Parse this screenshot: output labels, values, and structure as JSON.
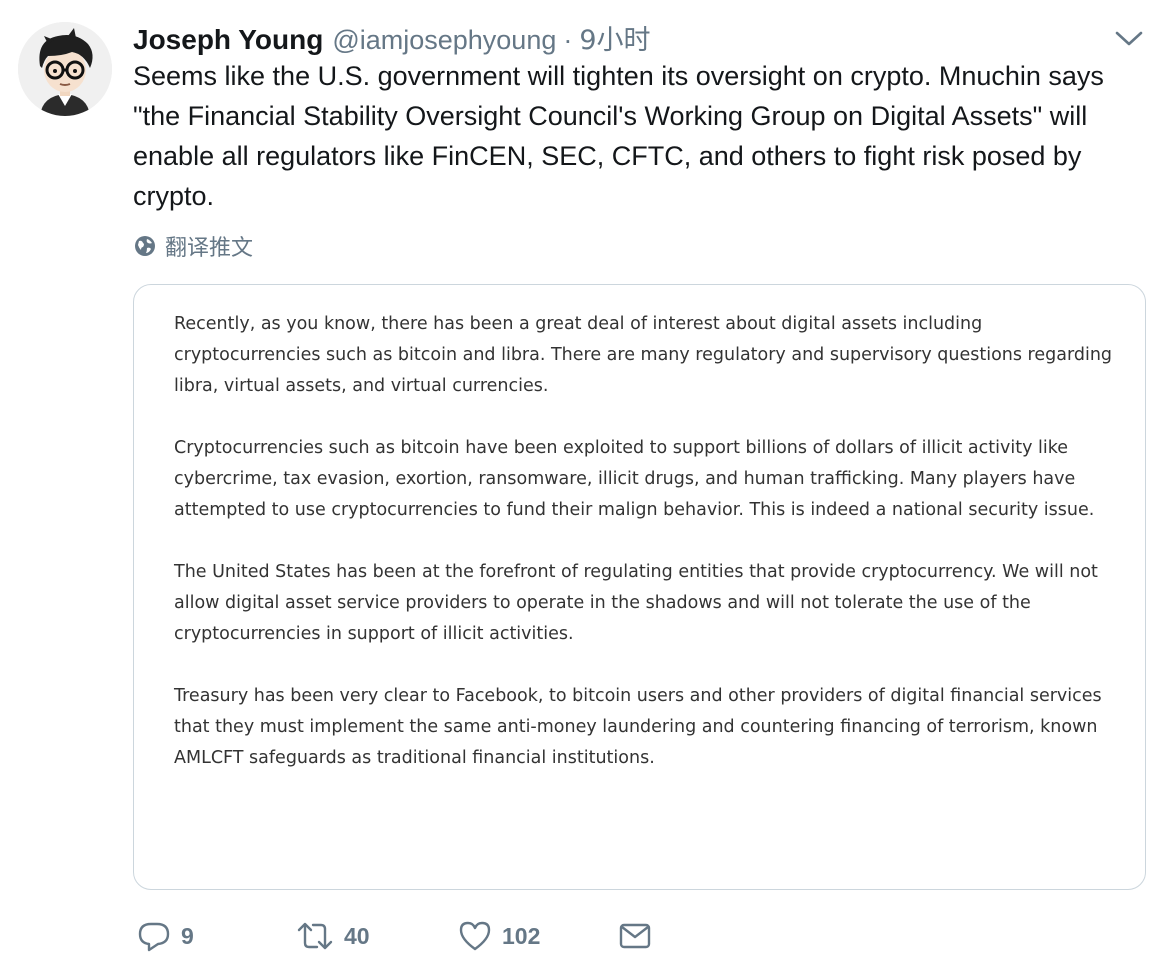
{
  "tweet": {
    "author_name": "Joseph Young",
    "author_handle": "@iamjosephyoung",
    "separator": "·",
    "timestamp": "9小时",
    "text": "Seems like the U.S. government will tighten its oversight on crypto. Mnuchin says \"the Financial Stability Oversight Council's Working Group on Digital Assets\" will enable all regulators like FinCEN, SEC, CFTC, and others to fight risk posed by crypto.",
    "translate_label": "翻译推文"
  },
  "media": {
    "paragraphs": [
      "Recently, as you know, there has been a great deal of interest about digital assets including cryptocurrencies such as bitcoin and libra. There are many regulatory and supervisory questions regarding libra, virtual assets, and virtual currencies.",
      "Cryptocurrencies such as bitcoin have been exploited to support billions of dollars of illicit activity like cybercrime, tax evasion, exortion, ransomware, illicit drugs, and human trafficking. Many players have attempted to use cryptocurrencies to fund their malign behavior. This is indeed a national security issue.",
      "The United States has been at the forefront of regulating entities that provide cryptocurrency. We will not allow digital asset service providers to operate in the shadows and will not tolerate the use of the cryptocurrencies in support of illicit activities.",
      "Treasury has been very clear to Facebook, to bitcoin users and other providers of digital financial services that they must implement the same anti-money laundering and countering financing of terrorism, known AMLCFT safeguards as traditional financial institutions."
    ]
  },
  "actions": {
    "replies": "9",
    "retweets": "40",
    "likes": "102"
  },
  "icons": {
    "avatar": "avatar-cartoon-glasses",
    "caret": "chevron-down-icon",
    "translate": "globe-icon",
    "reply": "reply-icon",
    "retweet": "retweet-icon",
    "like": "heart-icon",
    "dm": "envelope-icon"
  },
  "colors": {
    "text": "#14171a",
    "secondary": "#657786",
    "border": "#ccd6dd"
  }
}
